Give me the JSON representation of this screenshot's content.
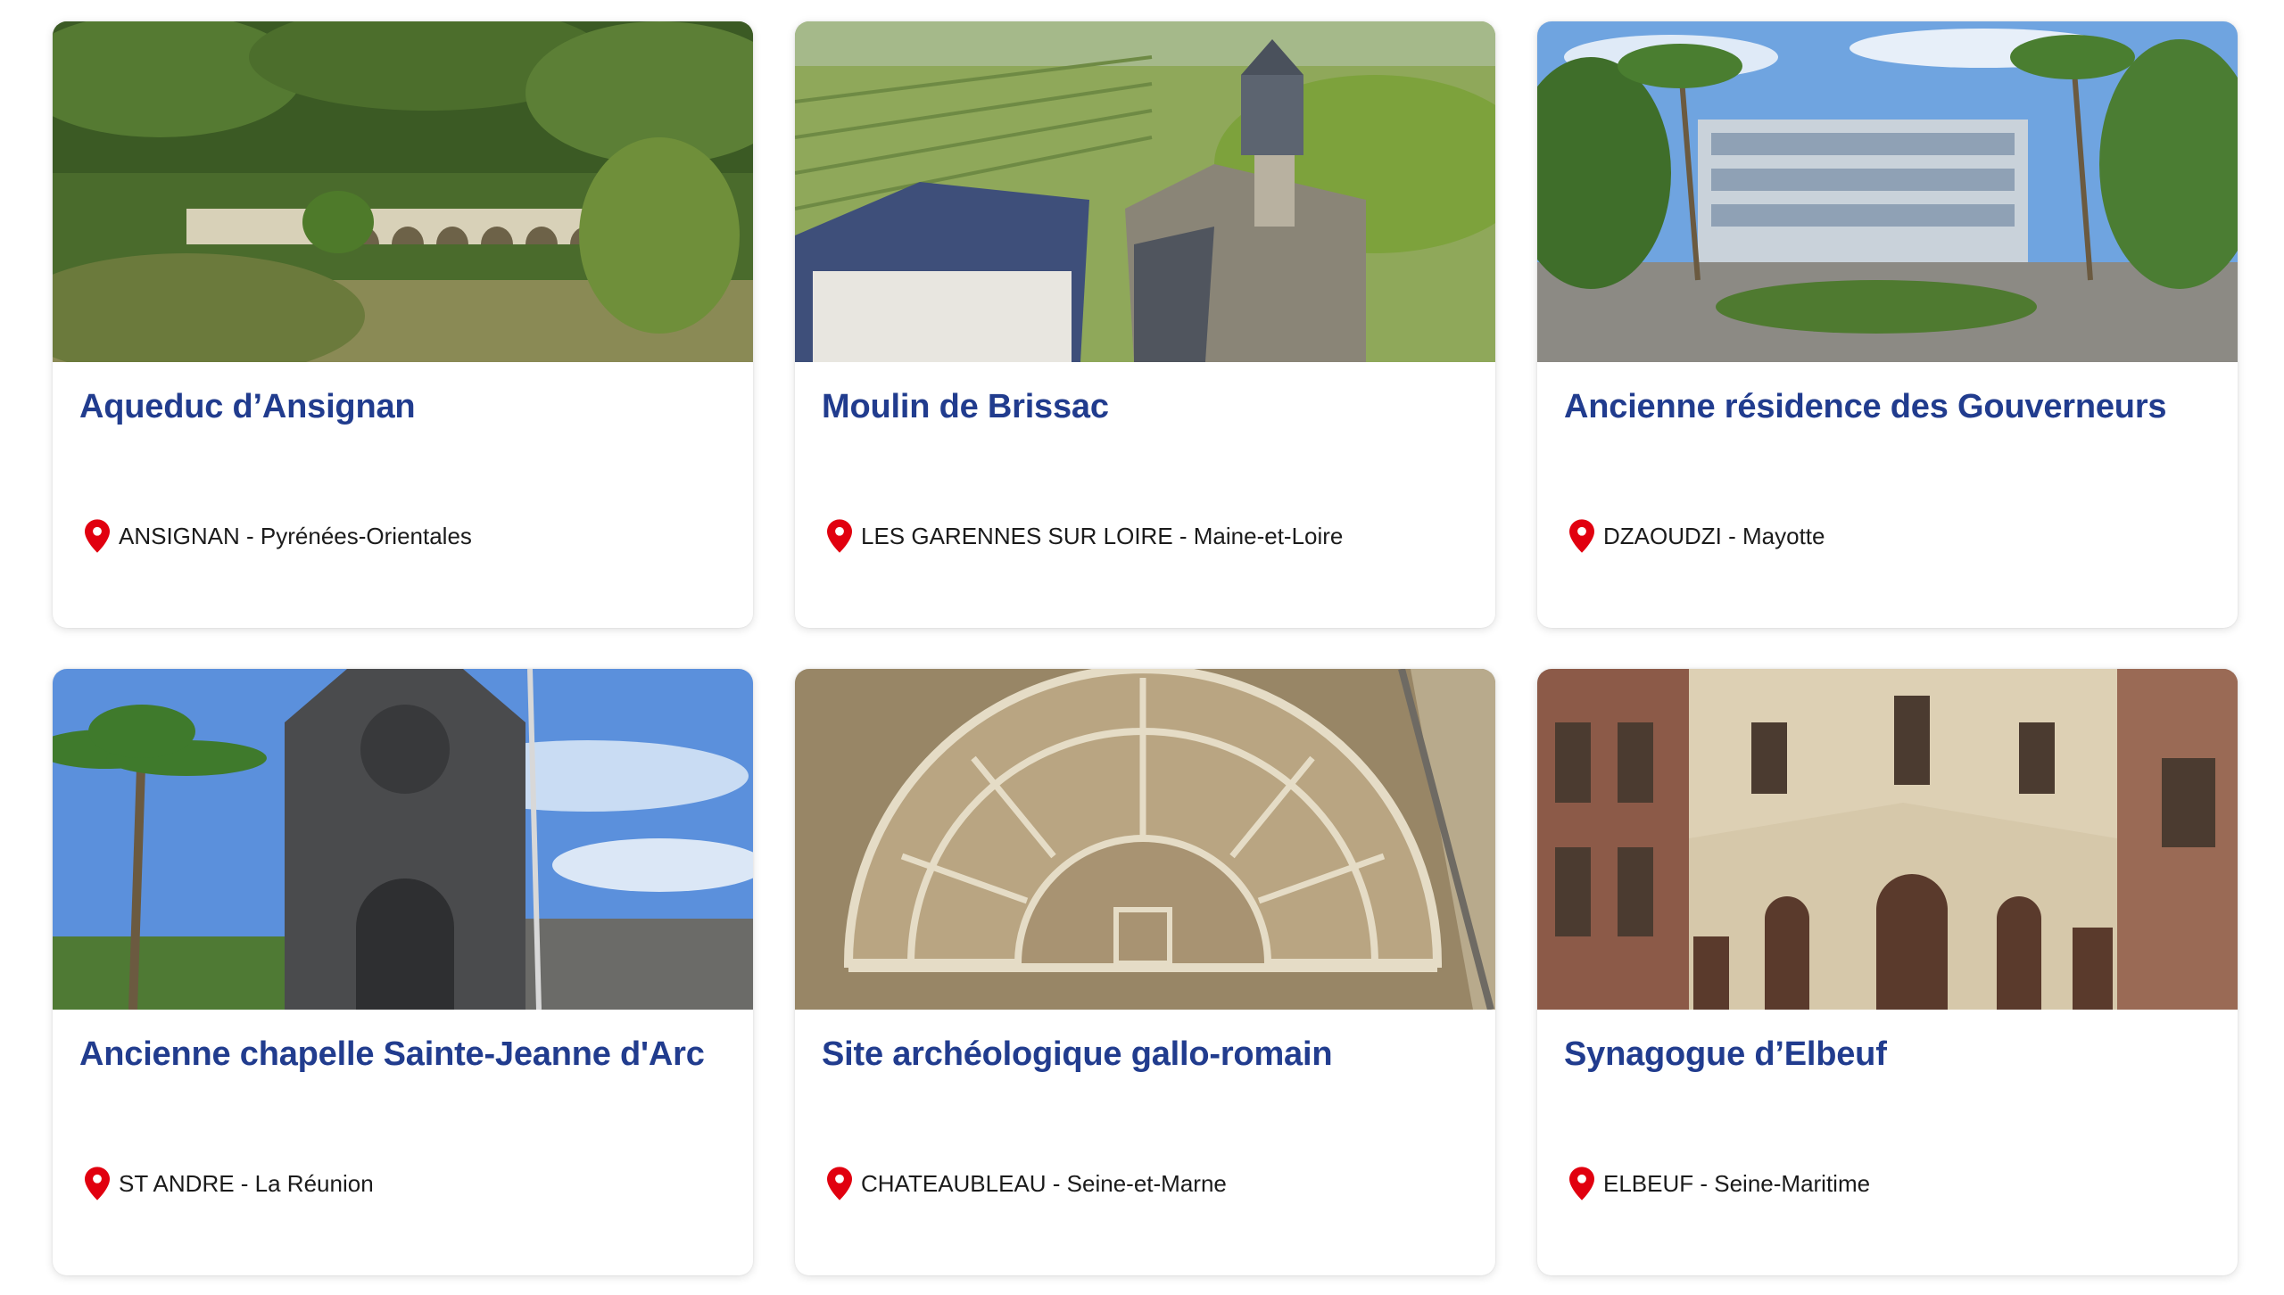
{
  "cards": [
    {
      "title": "Aqueduc d’Ansignan",
      "location": "ANSIGNAN - Pyrénées-Orientales",
      "image": "aqueduct-photo"
    },
    {
      "title": "Moulin de Brissac",
      "location": "LES GARENNES SUR LOIRE - Maine-et-Loire",
      "image": "windmill-photo"
    },
    {
      "title": "Ancienne résidence des Gouverneurs",
      "location": "DZAOUDZI - Mayotte",
      "image": "governor-residence-photo"
    },
    {
      "title": "Ancienne chapelle Sainte-Jeanne d'Arc",
      "location": "ST ANDRE - La Réunion",
      "image": "chapel-photo"
    },
    {
      "title": "Site archéologique gallo-romain",
      "location": "CHATEAUBLEAU - Seine-et-Marne",
      "image": "archaeological-site-photo"
    },
    {
      "title": "Synagogue d’Elbeuf",
      "location": "ELBEUF - Seine-Maritime",
      "image": "synagogue-photo"
    }
  ],
  "colors": {
    "title": "#213c8e",
    "pin": "#e1000f",
    "text": "#1b1b1b"
  },
  "icons": {
    "location": "map-pin-icon"
  }
}
